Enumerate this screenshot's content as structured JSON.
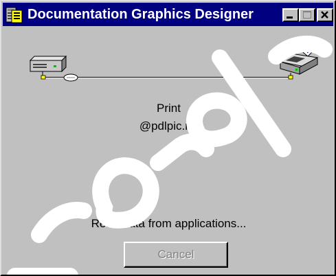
{
  "window": {
    "title": "Documentation Graphics Designer"
  },
  "titlebar_buttons": {
    "minimize_icon": "minimize-icon",
    "maximize_icon": "maximize-icon",
    "close_icon": "close-icon"
  },
  "transfer": {
    "source_icon": "computer-icon",
    "destination_icon": "printer-icon",
    "action_label": "Print",
    "file_name": "@pdlpic.rpl"
  },
  "status": {
    "message": "Read data from applications..."
  },
  "buttons": {
    "cancel_label": "Cancel",
    "cancel_enabled": false
  },
  "colors": {
    "titlebar": "#000080",
    "dialog_face": "#c0c0c0",
    "disabled_text": "#808080"
  }
}
